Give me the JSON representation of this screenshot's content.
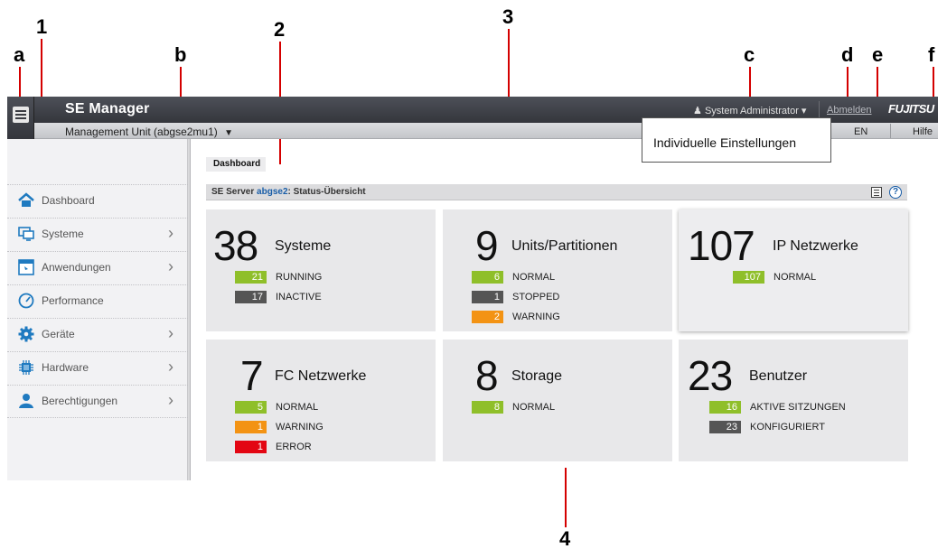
{
  "callouts": {
    "c1": "1",
    "c2": "2",
    "c3": "3",
    "c4": "4",
    "ca": "a",
    "cb": "b",
    "cc": "c",
    "cd": "d",
    "ce": "e",
    "cf": "f"
  },
  "colors": {
    "green": "#8fbf2a",
    "gray": "#555555",
    "orange": "#f39314",
    "red": "#e30613",
    "link": "#1a5ea8",
    "callout_line": "#d40000"
  },
  "header": {
    "menu_icon": "hamburger-menu-icon",
    "app_title": "SE Manager",
    "user": "System Administrator",
    "logout": "Abmelden",
    "logo": "FUJITSU",
    "management_unit": "Management Unit (abgse2mu1)",
    "lang": "EN",
    "help": "Hilfe"
  },
  "tooltip": "Individuelle Einstellungen",
  "sidebar": {
    "items": [
      {
        "label": "Dashboard",
        "icon": "home-icon"
      },
      {
        "label": "Systeme",
        "icon": "monitor-icon"
      },
      {
        "label": "Anwendungen",
        "icon": "window-icon"
      },
      {
        "label": "Performance",
        "icon": "gauge-icon"
      },
      {
        "label": "Geräte",
        "icon": "gear-icon"
      },
      {
        "label": "Hardware",
        "icon": "chip-icon"
      },
      {
        "label": "Berechtigungen",
        "icon": "user-icon"
      }
    ]
  },
  "main": {
    "breadcrumb": "Dashboard",
    "section_prefix": "SE Server ",
    "section_server": "abgse2",
    "section_suffix": ": Status-Übersicht",
    "cards": [
      {
        "count": "38",
        "title": "Systeme",
        "rows": [
          {
            "value": "21",
            "label": "RUNNING",
            "color": "green"
          },
          {
            "value": "17",
            "label": "INACTIVE",
            "color": "gray"
          }
        ]
      },
      {
        "count": "9",
        "title": "Units/Partitionen",
        "rows": [
          {
            "value": "6",
            "label": "NORMAL",
            "color": "green"
          },
          {
            "value": "1",
            "label": "STOPPED",
            "color": "gray"
          },
          {
            "value": "2",
            "label": "WARNING",
            "color": "orange"
          }
        ]
      },
      {
        "count": "107",
        "title": "IP Netzwerke",
        "rows": [
          {
            "value": "107",
            "label": "NORMAL",
            "color": "green"
          }
        ]
      },
      {
        "count": "7",
        "title": "FC Netzwerke",
        "rows": [
          {
            "value": "5",
            "label": "NORMAL",
            "color": "green"
          },
          {
            "value": "1",
            "label": "WARNING",
            "color": "orange"
          },
          {
            "value": "1",
            "label": "ERROR",
            "color": "red"
          }
        ]
      },
      {
        "count": "8",
        "title": "Storage",
        "rows": [
          {
            "value": "8",
            "label": "NORMAL",
            "color": "green"
          }
        ]
      },
      {
        "count": "23",
        "title": "Benutzer",
        "rows": [
          {
            "value": "16",
            "label": "AKTIVE SITZUNGEN",
            "color": "green"
          },
          {
            "value": "23",
            "label": "KONFIGURIERT",
            "color": "gray"
          }
        ]
      }
    ]
  }
}
